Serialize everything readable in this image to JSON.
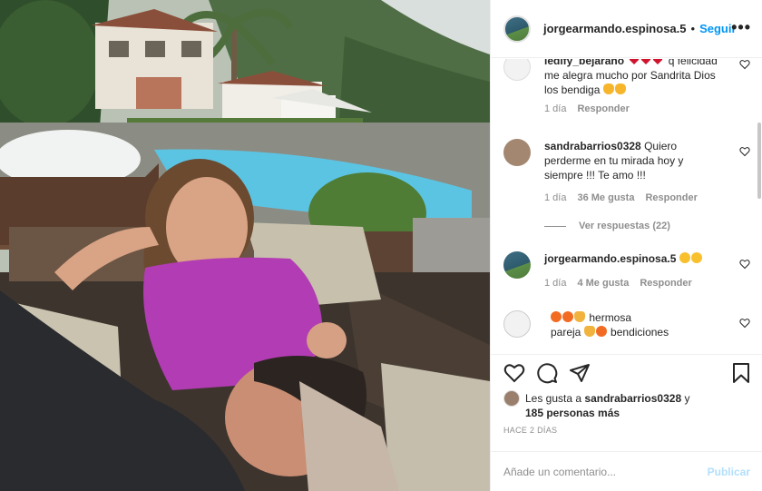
{
  "post": {
    "author": "jorgearmando.espinosa.5",
    "follow_label": "Seguir",
    "separator": "•",
    "more_label": "•••"
  },
  "comments": [
    {
      "username": "ledify_bejarano",
      "text": "q felicidad me alegra mucho por Sandrita Dios los bendiga",
      "time": "1 día",
      "likes": "",
      "reply_label": "Responder"
    },
    {
      "username": "sandrabarrios0328",
      "text": "Quiero perderme en tu mirada hoy y siempre !!! Te amo !!!",
      "time": "1 día",
      "likes": "36 Me gusta",
      "reply_label": "Responder",
      "view_replies": "Ver respuestas (22)"
    },
    {
      "username": "jorgearmando.espinosa.5",
      "text": "",
      "time": "1 día",
      "likes": "4 Me gusta",
      "reply_label": "Responder"
    },
    {
      "username": "",
      "text_part1": "hermosa",
      "text_part2": "pareja",
      "text_part3": "bendiciones"
    }
  ],
  "likes_summary": {
    "prefix": "Les gusta a",
    "user": "sandrabarrios0328",
    "connector": "y",
    "others": "185 personas más"
  },
  "time_ago": "HACE 2 DÍAS",
  "comment_input": {
    "placeholder": "Añade un comentario...",
    "publish_label": "Publicar"
  },
  "colors": {
    "accent": "#0095f6",
    "publish_disabled": "#b2dffc",
    "secondary_text": "#8e8e8e"
  }
}
